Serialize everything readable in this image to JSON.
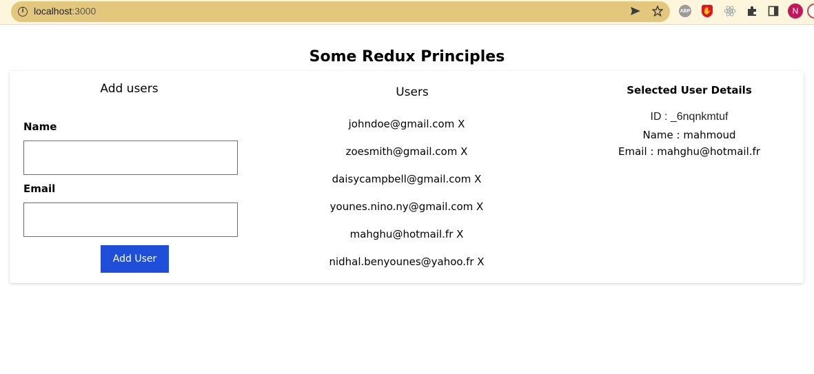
{
  "browser": {
    "url_host": "localhost",
    "url_port": ":3000",
    "avatar_letter": "N",
    "abp_label": "ABP"
  },
  "page": {
    "title": "Some Redux Principles"
  },
  "add_users": {
    "title": "Add users",
    "name_label": "Name",
    "name_value": "",
    "email_label": "Email",
    "email_value": "",
    "button_label": "Add User"
  },
  "users": {
    "title": "Users",
    "items": [
      "johndoe@gmail.com X",
      "zoesmith@gmail.com X",
      "daisycampbell@gmail.com X",
      "younes.nino.ny@gmail.com X",
      "mahghu@hotmail.fr X",
      "nidhal.benyounes@yahoo.fr X"
    ]
  },
  "selected_user": {
    "title": "Selected User Details",
    "id_line": "ID : _6nqnkmtuf",
    "name_line": "Name : mahmoud",
    "email_line": "Email : mahghu@hotmail.fr"
  },
  "colors": {
    "button": "#1f4fd8",
    "toolbar": "#fdf5dc",
    "omnibox": "#e3c77d"
  }
}
